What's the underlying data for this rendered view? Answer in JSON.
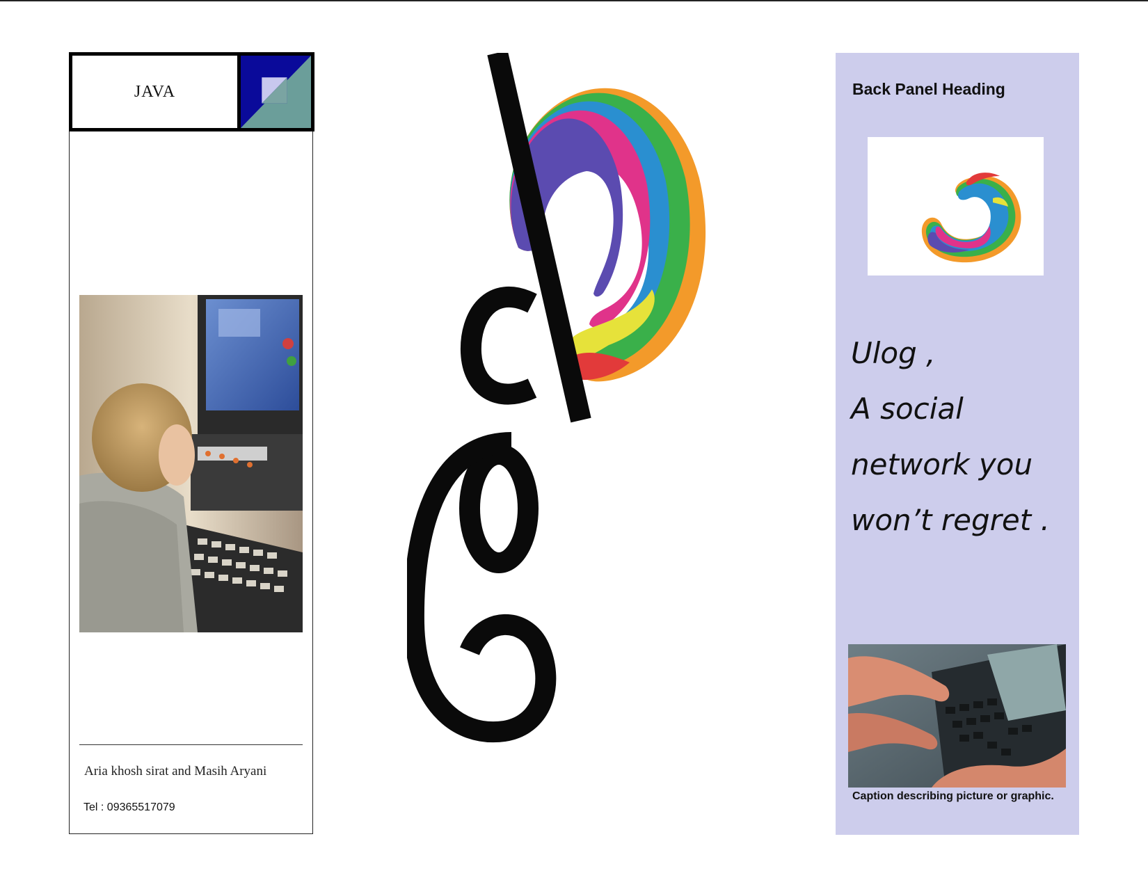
{
  "left_panel": {
    "header_label": "JAVA",
    "authors": "Aria khosh sirat and Masih Aryani",
    "tel": "Tel : 09365517079",
    "photo_subject": "child-at-computer-photo"
  },
  "center": {
    "logo_icon": "rainbow-swirl-logo",
    "wordmark_icon": "stylized-glyph-wordmark"
  },
  "right_panel": {
    "heading": "Back Panel Heading",
    "logo_icon": "rainbow-swirl-logo",
    "slogan_lines": [
      "Ulog ,",
      " A social",
      "network you",
      "won’t regret ."
    ],
    "photo_subject": "hands-typing-handheld-device-photo",
    "caption": "Caption describing picture or graphic."
  },
  "colors": {
    "panel_background": "#cdcdec",
    "emblem_blue": "#0a0a9a",
    "emblem_teal": "#6b9e9a"
  }
}
